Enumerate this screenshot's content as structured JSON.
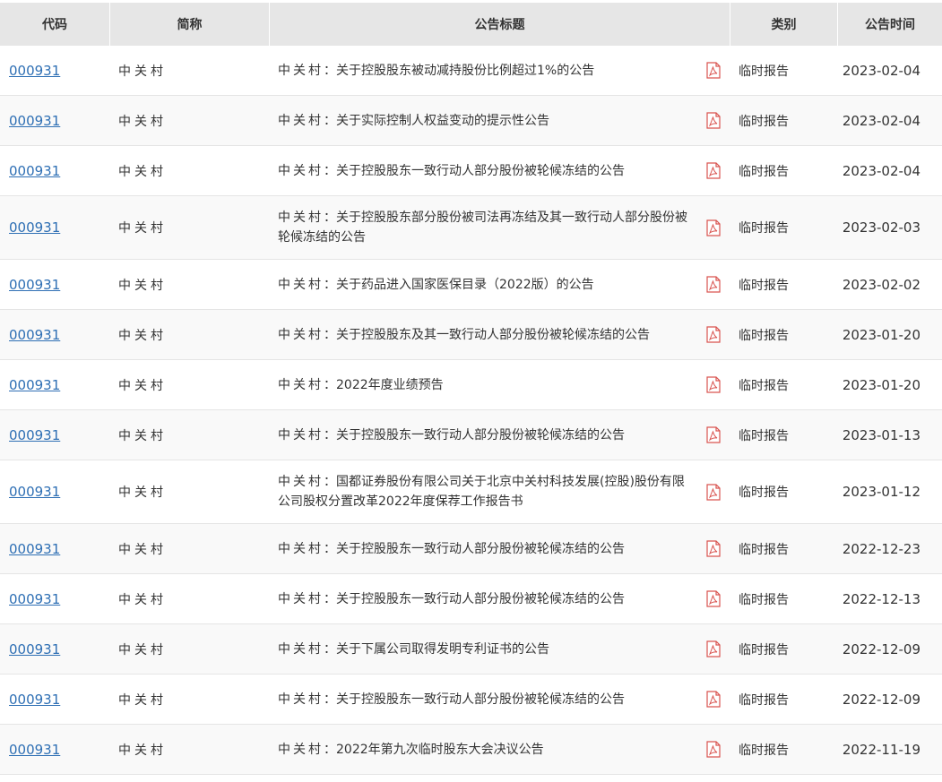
{
  "headers": [
    "代码",
    "简称",
    "公告标题",
    "类别",
    "公告时间"
  ],
  "rows": [
    {
      "code": "000931",
      "abbr": "中关村",
      "title": "关于控股股东被动减持股份比例超过1%的公告",
      "type": "临时报告",
      "date": "2023-02-04"
    },
    {
      "code": "000931",
      "abbr": "中关村",
      "title": "关于实际控制人权益变动的提示性公告",
      "type": "临时报告",
      "date": "2023-02-04"
    },
    {
      "code": "000931",
      "abbr": "中关村",
      "title": "关于控股股东一致行动人部分股份被轮候冻结的公告",
      "type": "临时报告",
      "date": "2023-02-04"
    },
    {
      "code": "000931",
      "abbr": "中关村",
      "title": "关于控股股东部分股份被司法再冻结及其一致行动人部分股份被轮候冻结的公告",
      "type": "临时报告",
      "date": "2023-02-03"
    },
    {
      "code": "000931",
      "abbr": "中关村",
      "title": "关于药品进入国家医保目录（2022版）的公告",
      "type": "临时报告",
      "date": "2023-02-02"
    },
    {
      "code": "000931",
      "abbr": "中关村",
      "title": "关于控股股东及其一致行动人部分股份被轮候冻结的公告",
      "type": "临时报告",
      "date": "2023-01-20"
    },
    {
      "code": "000931",
      "abbr": "中关村",
      "title": "2022年度业绩预告",
      "type": "临时报告",
      "date": "2023-01-20"
    },
    {
      "code": "000931",
      "abbr": "中关村",
      "title": "关于控股股东一致行动人部分股份被轮候冻结的公告",
      "type": "临时报告",
      "date": "2023-01-13"
    },
    {
      "code": "000931",
      "abbr": "中关村",
      "title": "国都证券股份有限公司关于北京中关村科技发展(控股)股份有限公司股权分置改革2022年度保荐工作报告书",
      "type": "临时报告",
      "date": "2023-01-12"
    },
    {
      "code": "000931",
      "abbr": "中关村",
      "title": "关于控股股东一致行动人部分股份被轮候冻结的公告",
      "type": "临时报告",
      "date": "2022-12-23"
    },
    {
      "code": "000931",
      "abbr": "中关村",
      "title": "关于控股股东一致行动人部分股份被轮候冻结的公告",
      "type": "临时报告",
      "date": "2022-12-13"
    },
    {
      "code": "000931",
      "abbr": "中关村",
      "title": "关于下属公司取得发明专利证书的公告",
      "type": "临时报告",
      "date": "2022-12-09"
    },
    {
      "code": "000931",
      "abbr": "中关村",
      "title": "关于控股股东一致行动人部分股份被轮候冻结的公告",
      "type": "临时报告",
      "date": "2022-12-09"
    },
    {
      "code": "000931",
      "abbr": "中关村",
      "title": "2022年第九次临时股东大会决议公告",
      "type": "临时报告",
      "date": "2022-11-19"
    }
  ],
  "icons": {
    "pdf": "pdf-icon"
  },
  "colors": {
    "link": "#2e6fb4",
    "header_bg": "#e6e6e6",
    "pdf_icon": "#d9534f"
  }
}
